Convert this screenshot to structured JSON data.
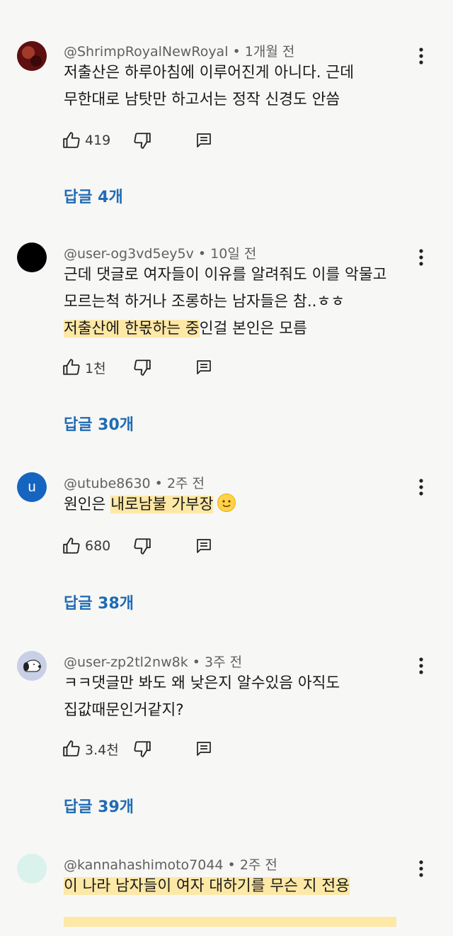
{
  "comments": [
    {
      "author": "@ShrimpRoyalNewRoyal",
      "time": "1개월 전",
      "lines": [
        [
          {
            "text": "저출산은 하루아침에 이루어진게 아니다. 근데",
            "hl": false
          }
        ],
        [
          {
            "text": "무한대로 남탓만 하고서는 정작 신경도 안씀",
            "hl": false
          }
        ]
      ],
      "likes": "419",
      "replies": "답글 4개",
      "avatar": {
        "type": "photo",
        "color": "#7a1c1c"
      }
    },
    {
      "author": "@user-og3vd5ey5v",
      "time": "10일 전",
      "lines": [
        [
          {
            "text": "근데 댓글로 여자들이 이유를 알려줘도 이를 악물고",
            "hl": false
          }
        ],
        [
          {
            "text": "모르는척 하거나 조롱하는 남자들은 참..ㅎㅎ",
            "hl": false
          }
        ],
        [
          {
            "text": "저출산에 한몫하는 중",
            "hl": true
          },
          {
            "text": "인걸 본인은 모름",
            "hl": false
          }
        ]
      ],
      "likes": "1천",
      "replies": "답글 30개",
      "avatar": {
        "type": "solid",
        "color": "#000000"
      }
    },
    {
      "author": "@utube8630",
      "time": "2주 전",
      "lines": [
        [
          {
            "text": "원인은 ",
            "hl": false
          },
          {
            "text": "내로남불 가부장",
            "hl": true
          }
        ]
      ],
      "has_emoji": true,
      "likes": "680",
      "replies": "답글 38개",
      "avatar": {
        "type": "letter",
        "letter": "u",
        "color": "#1565c0"
      }
    },
    {
      "author": "@user-zp2tl2nw8k",
      "time": "3주 전",
      "lines": [
        [
          {
            "text": "ㅋㅋ댓글만 봐도 왜 낮은지 알수있음 아직도",
            "hl": false
          }
        ],
        [
          {
            "text": "집값때문인거같지?",
            "hl": false
          }
        ]
      ],
      "likes": "3.4천",
      "replies": "답글 39개",
      "avatar": {
        "type": "snoopy",
        "color": "#c9cfe6"
      }
    },
    {
      "author": "@kannahashimoto7044",
      "time": "2주 전",
      "lines": [
        [
          {
            "text": "이 나라 남자들이 여자 대하기를 무슨 지 전용",
            "hl": true
          }
        ]
      ],
      "likes": "",
      "replies": "",
      "avatar": {
        "type": "solid",
        "color": "#d9f2ec"
      }
    }
  ],
  "icons": {
    "like": "thumbs-up-icon",
    "dislike": "thumbs-down-icon",
    "reply": "comment-icon",
    "menu": "more-vertical-icon"
  },
  "colors": {
    "reply_link": "#1f6bb5",
    "highlight": "#fde8a6",
    "meta": "#606060"
  }
}
